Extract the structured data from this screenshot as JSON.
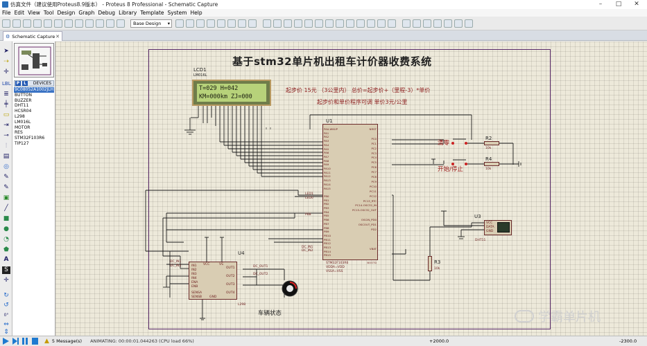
{
  "window": {
    "title": "仿真文件（建议使用Proteus8.9版本） - Proteus 8 Professional - Schematic Capture",
    "min": "–",
    "max": "□",
    "close": "✕"
  },
  "menu": [
    "File",
    "Edit",
    "View",
    "Tool",
    "Design",
    "Graph",
    "Debug",
    "Library",
    "Template",
    "System",
    "Help"
  ],
  "toolbar": {
    "variant": "Base Design"
  },
  "tab": {
    "label": "Schematic Capture",
    "close": "✕"
  },
  "devices": {
    "p": "P",
    "l": "L",
    "header": "DEVICES",
    "items": [
      "9C08052A1002JLH",
      "BUTTON",
      "BUZZER",
      "DHT11",
      "HCSR04",
      "L298",
      "LM016L",
      "MOTOR",
      "RES",
      "STM32F103R6",
      "TIP127"
    ],
    "selected": 0
  },
  "schematic": {
    "title": "基于stm32单片机出租车计价器收费系统",
    "note1": "起步价 15元  （3公里内）   总价=起步价+（里程-3）*单价",
    "note2": "起步价和单价程序可调  单价3元/公里",
    "lcd": {
      "ref": "LCD1",
      "part": "LM016L",
      "line1": "T=029  H=042",
      "line2": "KM=000km  ZJ=000"
    },
    "u1": {
      "ref": "U1",
      "part": "STM32F103R6",
      "pins": [
        "VDDA=VDD",
        "VSSA=VSS"
      ]
    },
    "u4": {
      "ref": "U4",
      "part": "L298"
    },
    "u3": {
      "ref": "U3",
      "part": "DHT11"
    },
    "r2": "R2",
    "r4": "R4",
    "r3": "R3",
    "rval": "10k",
    "btn_clear": "清零",
    "btn_startstop": "开始/停止",
    "vehicle_state": "车辆状态",
    "net_dcout1": "DC_OUT1",
    "net_dcout2": "DC_OUT2",
    "net_dcin1": "DC_IN1",
    "net_dcin2": "DC_IN2",
    "net_led1": "LED1",
    "net_led0": "LED0",
    "net_pb8": "PB8",
    "u1_left_pins": [
      "PA0-WKUP",
      "PA1",
      "PA2",
      "PA3",
      "PA4",
      "PA5",
      "PA6",
      "PA7",
      "PA8",
      "PA9",
      "PA10",
      "PA11",
      "PA12",
      "PA13",
      "PA14",
      "PA15",
      "",
      "PB0",
      "PB1",
      "PB2",
      "PB3",
      "PB4",
      "PB5",
      "PB6",
      "PB7",
      "PB8",
      "PB9",
      "PB10",
      "PB11",
      "PB12",
      "PB13",
      "PB14",
      "PB15"
    ],
    "u1_right_pins": [
      "NRST",
      "",
      "PC0",
      "PC1",
      "PC2",
      "PC3",
      "PC4",
      "PC5",
      "PC6",
      "PC7",
      "PC8",
      "PC9",
      "PC10",
      "PC11",
      "PC12",
      "PC13_RTC",
      "PC14-OSC32_IN",
      "PC15-OSC32_OUT",
      "",
      "OSCIN_PD0",
      "OSCOUT_PD1",
      "PD2",
      "",
      "",
      "",
      "VBAT",
      "",
      "",
      "BOOT0"
    ]
  },
  "status": {
    "messages": "5 Message(s)",
    "anim": "ANIMATING: 00:00:01.044263 (CPU load 66%)",
    "coord_x": "+2000.0",
    "coord_y": "-2300.0"
  },
  "watermark": "学霸单片机"
}
